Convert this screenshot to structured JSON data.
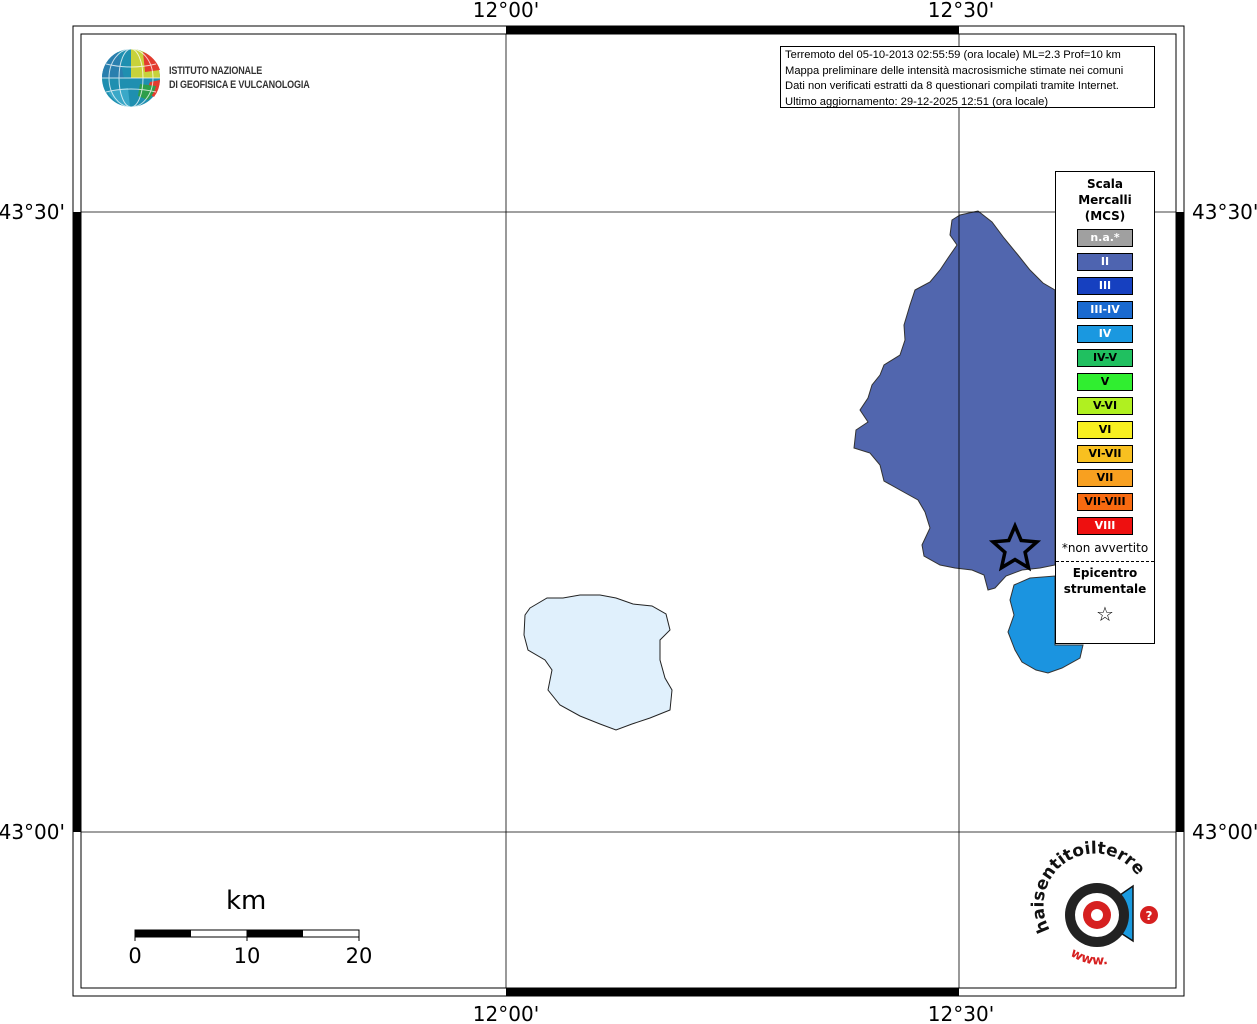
{
  "map": {
    "lon_labels": [
      "12°00'",
      "12°30'"
    ],
    "lat_labels": [
      "43°30'",
      "43°00'"
    ]
  },
  "institute": {
    "line1": "ISTITUTO NAZIONALE",
    "line2": "DI GEOFISICA E VULCANOLOGIA"
  },
  "info": {
    "line1": "Terremoto del 05-10-2013 02:55:59 (ora locale) ML=2.3 Prof=10 km",
    "line2": "Mappa preliminare delle intensità macrosismiche stimate nei comuni",
    "line3": "Dati non verificati estratti da 8 questionari compilati tramite Internet.",
    "line4": "Ultimo aggiornamento: 29-12-2025 12:51 (ora locale)"
  },
  "legend": {
    "title_line1": "Scala",
    "title_line2": "Mercalli",
    "title_line3": "(MCS)",
    "items": [
      {
        "label": "n.a.*",
        "color": "#a0a0a0",
        "text_color": "#ffffff"
      },
      {
        "label": "II",
        "color": "#4e64b0",
        "text_color": "#ffffff"
      },
      {
        "label": "III",
        "color": "#1640c0",
        "text_color": "#ffffff"
      },
      {
        "label": "III-IV",
        "color": "#1a6ad0",
        "text_color": "#ffffff"
      },
      {
        "label": "IV",
        "color": "#1a98e0",
        "text_color": "#ffffff"
      },
      {
        "label": "IV-V",
        "color": "#20c060",
        "text_color": "#000000"
      },
      {
        "label": "V",
        "color": "#30ee30",
        "text_color": "#000000"
      },
      {
        "label": "V-VI",
        "color": "#b0f020",
        "text_color": "#000000"
      },
      {
        "label": "VI",
        "color": "#f8f020",
        "text_color": "#000000"
      },
      {
        "label": "VI-VII",
        "color": "#f8c020",
        "text_color": "#000000"
      },
      {
        "label": "VII",
        "color": "#f8a020",
        "text_color": "#000000"
      },
      {
        "label": "VII-VIII",
        "color": "#f86a10",
        "text_color": "#000000"
      },
      {
        "label": "VIII",
        "color": "#ee1010",
        "text_color": "#ffffff"
      }
    ],
    "note": "*non avvertito",
    "epicentre_line1": "Epicentro",
    "epicentre_line2": "strumentale",
    "epicentre_symbol": "☆"
  },
  "scale_bar": {
    "unit": "km",
    "ticks": [
      "0",
      "10",
      "20"
    ]
  },
  "intensity_regions": [
    {
      "intensity": "II",
      "color": "#5166ae"
    },
    {
      "intensity": "IV",
      "color": "#1b94e0"
    }
  ],
  "lake": {
    "color": "#e0f0fc"
  },
  "haisentito_logo": {
    "text": "haisentitoilterremoto.it",
    "prefix": "www."
  }
}
